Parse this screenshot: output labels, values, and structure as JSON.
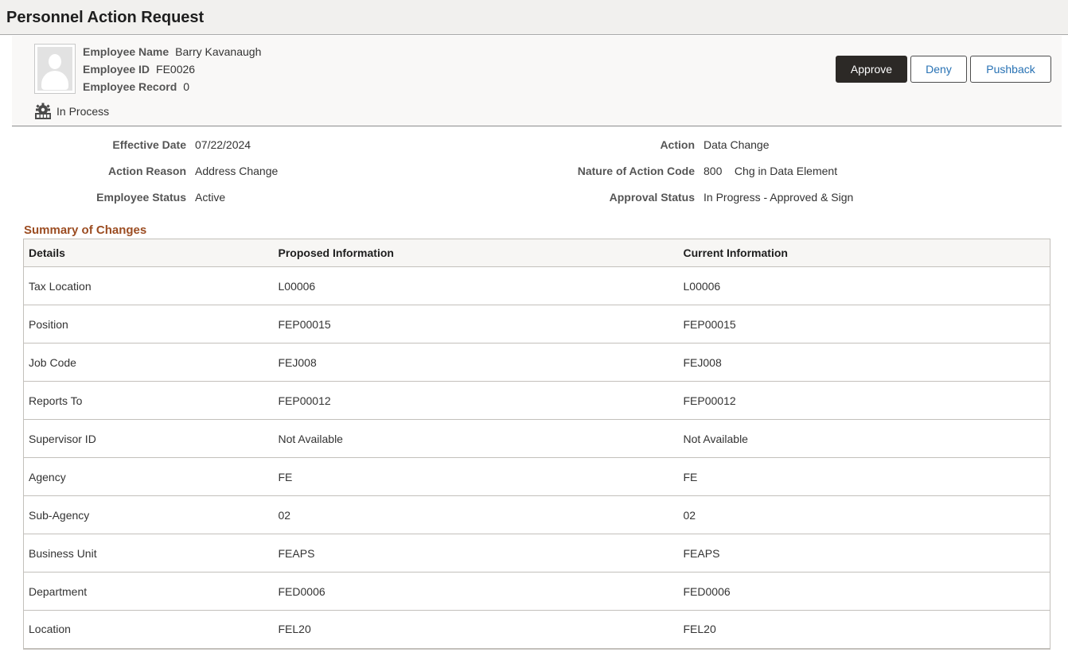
{
  "page": {
    "title": "Personnel Action Request"
  },
  "employee": {
    "name_label": "Employee Name",
    "name": "Barry Kavanaugh",
    "id_label": "Employee ID",
    "id": "FE0026",
    "record_label": "Employee Record",
    "record": "0",
    "status": "In Process",
    "avatar_icon": "person-placeholder-icon",
    "status_icon": "gear-process-icon"
  },
  "actions": {
    "approve": "Approve",
    "deny": "Deny",
    "pushback": "Pushback"
  },
  "details": {
    "left": [
      {
        "label": "Effective Date",
        "value": "07/22/2024"
      },
      {
        "label": "Action Reason",
        "value": "Address Change"
      },
      {
        "label": "Employee Status",
        "value": "Active"
      }
    ],
    "right": [
      {
        "label": "Action",
        "value": "Data Change"
      },
      {
        "label": "Nature of Action Code",
        "value": "800    Chg in Data Element"
      },
      {
        "label": "Approval Status",
        "value": "In Progress - Approved & Sign"
      }
    ]
  },
  "summary": {
    "title": "Summary of Changes",
    "headers": [
      "Details",
      "Proposed Information",
      "Current Information"
    ],
    "rows": [
      [
        "Tax Location",
        "L00006",
        "L00006"
      ],
      [
        "Position",
        "FEP00015",
        "FEP00015"
      ],
      [
        "Job Code",
        "FEJ008",
        "FEJ008"
      ],
      [
        "Reports To",
        "FEP00012",
        "FEP00012"
      ],
      [
        "Supervisor ID",
        "Not Available",
        "Not Available"
      ],
      [
        "Agency",
        "FE",
        "FE"
      ],
      [
        "Sub-Agency",
        "02",
        "02"
      ],
      [
        "Business Unit",
        "FEAPS",
        "FEAPS"
      ],
      [
        "Department",
        "FED0006",
        "FED0006"
      ],
      [
        "Location",
        "FEL20",
        "FEL20"
      ]
    ]
  },
  "colors": {
    "primary_button": "#2c2926",
    "link_blue": "#2872b4",
    "section_title": "#9c4d22",
    "header_bg": "#f1f0ee"
  }
}
